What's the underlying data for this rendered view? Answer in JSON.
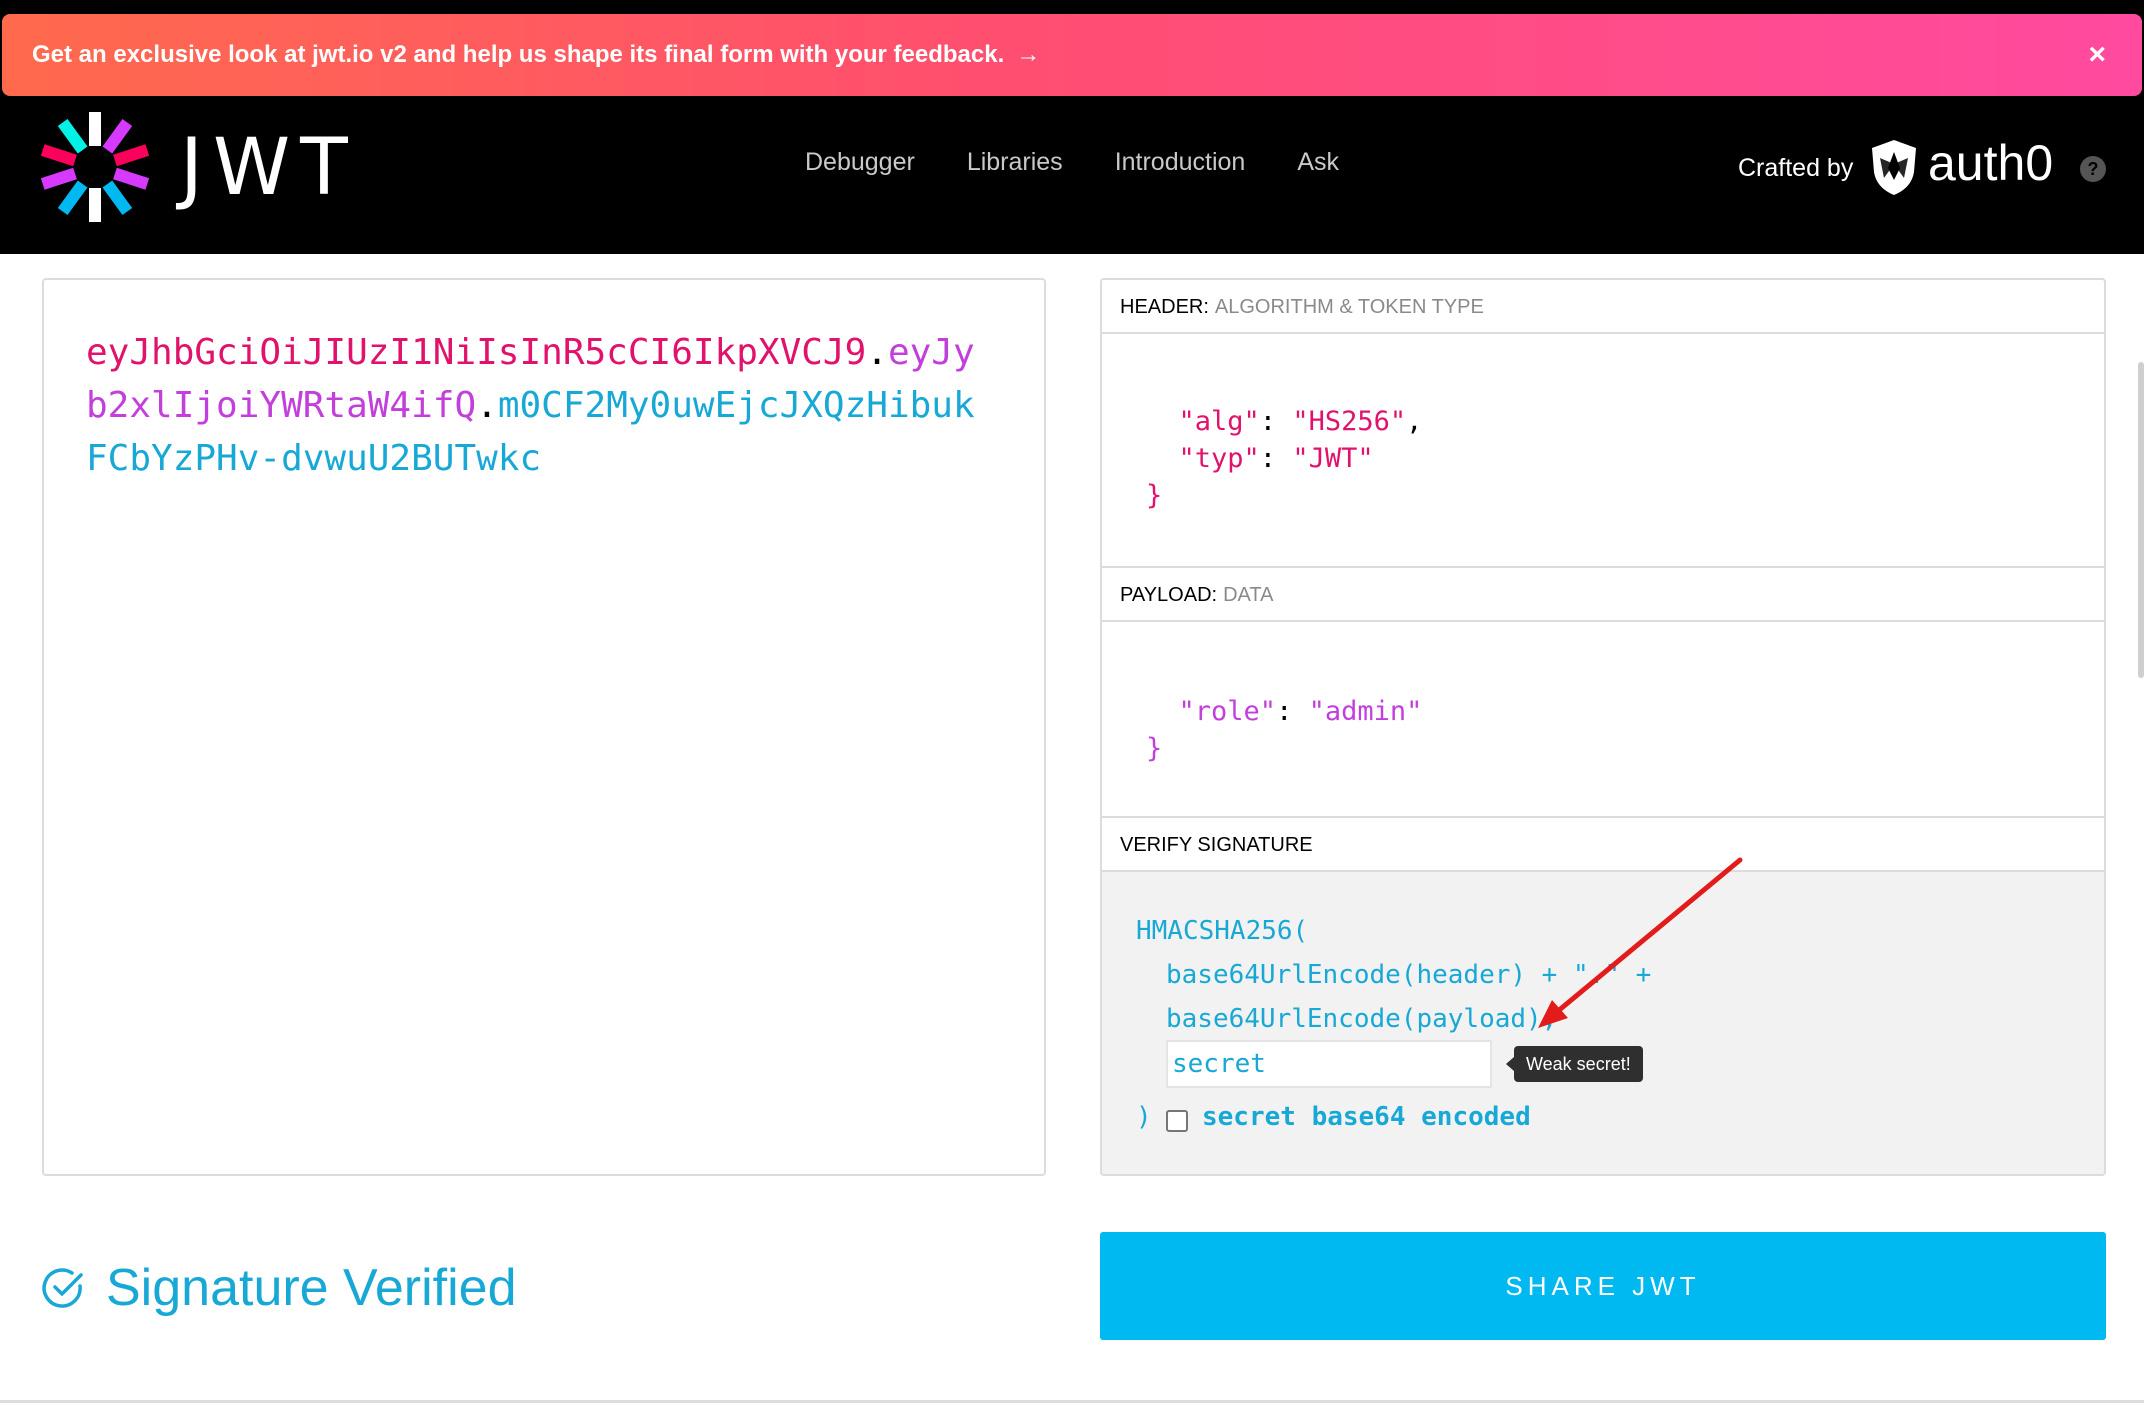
{
  "banner": {
    "text": "Get an exclusive look at jwt.io v2 and help us shape its final form with your feedback.",
    "arrow": "→",
    "close": "×"
  },
  "header": {
    "logo_text": "JWT",
    "nav": [
      "Debugger",
      "Libraries",
      "Introduction",
      "Ask"
    ],
    "crafted_by": "Crafted by",
    "brand": "auth0",
    "help": "?"
  },
  "encoded": {
    "header_part": "eyJhbGciOiJIUzI1NiIsInR5cCI6IkpXVCJ9",
    "payload_part": "eyJyb2xlIjoiYWRtaW4ifQ",
    "signature_part": "m0CF2My0uwEjcJXQzHibukFCbYzPHv-dvwuU2BUTwkc",
    "dot": "."
  },
  "decoded": {
    "header_section": {
      "title": "HEADER:",
      "subtitle": "ALGORITHM & TOKEN TYPE"
    },
    "header_json": {
      "alg_key": "\"alg\"",
      "alg_value": "\"HS256\"",
      "typ_key": "\"typ\"",
      "typ_value": "\"JWT\"",
      "close": "}"
    },
    "payload_section": {
      "title": "PAYLOAD:",
      "subtitle": "DATA"
    },
    "payload_json": {
      "role_key": "\"role\"",
      "role_value": "\"admin\"",
      "close": "}"
    },
    "verify_section": {
      "title": "VERIFY SIGNATURE"
    },
    "verify": {
      "fn_open": "HMACSHA256(",
      "line1": "base64UrlEncode(header) + \".\" +",
      "line2": "base64UrlEncode(payload),",
      "secret_value": "secret",
      "tooltip": "Weak secret!",
      "fn_close": ")",
      "base64_label": "secret base64 encoded"
    }
  },
  "status": {
    "text": "Signature Verified"
  },
  "share": {
    "label": "SHARE JWT"
  },
  "colors": {
    "header": "#e0126b",
    "payload": "#c33fdc",
    "signature": "#18a8d6",
    "share_button": "#00b9f1"
  }
}
